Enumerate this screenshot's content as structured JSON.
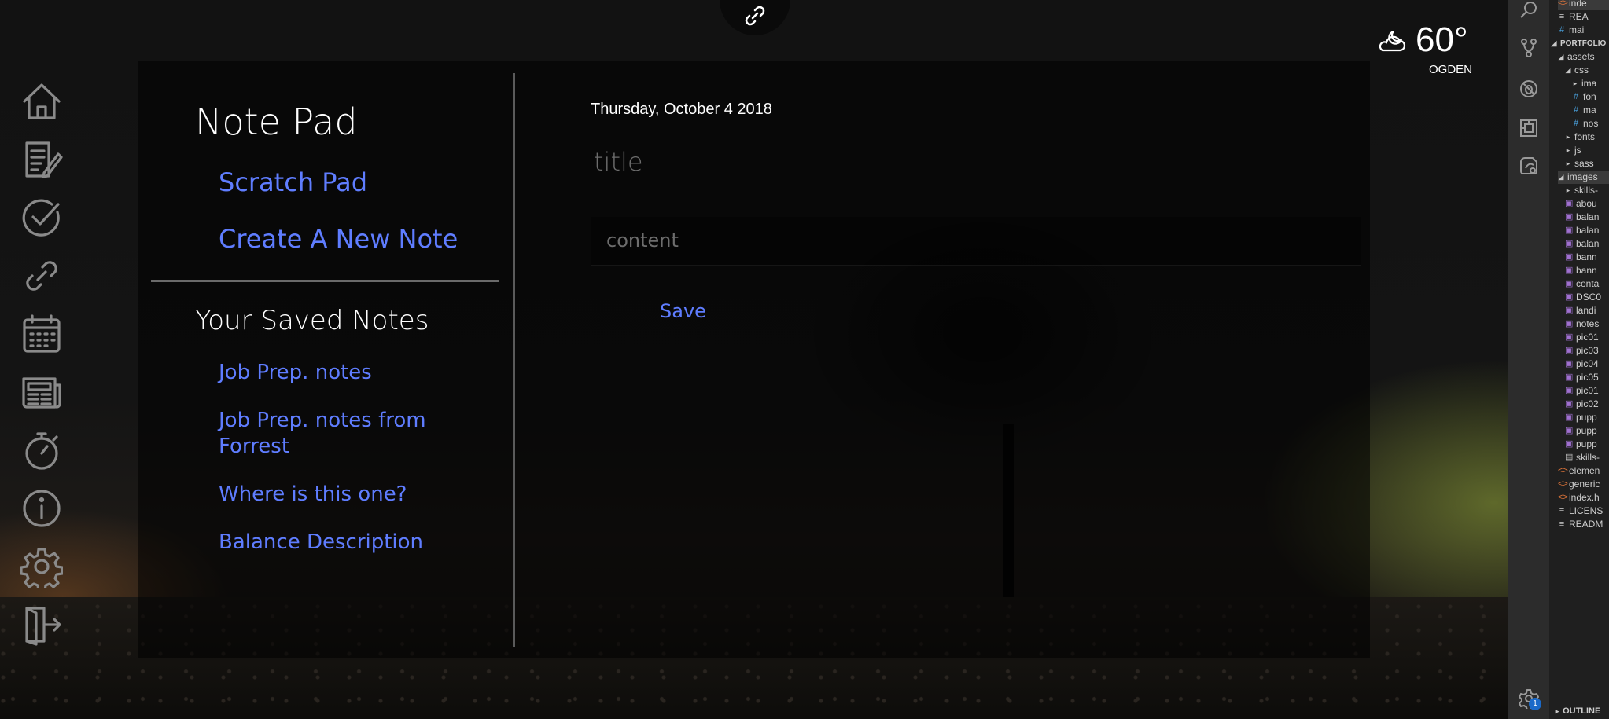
{
  "header": {
    "link_icon": "link-icon"
  },
  "weather": {
    "icon": "partly-cloudy-night-icon",
    "temperature": "60°",
    "city": "OGDEN"
  },
  "nav_rail": [
    {
      "icon": "home-icon"
    },
    {
      "icon": "notes-icon"
    },
    {
      "icon": "checklist-icon"
    },
    {
      "icon": "link-icon"
    },
    {
      "icon": "calendar-icon"
    },
    {
      "icon": "news-icon"
    },
    {
      "icon": "stopwatch-icon"
    },
    {
      "icon": "info-icon"
    },
    {
      "icon": "settings-icon"
    },
    {
      "icon": "logout-icon"
    }
  ],
  "sidebar": {
    "title": "Note Pad",
    "links": {
      "scratch": "Scratch Pad",
      "create": "Create A New Note"
    },
    "saved_title": "Your Saved Notes",
    "saved_notes": [
      "Job Prep. notes",
      "Job Prep. notes from Forrest",
      "Where is this one?",
      "Balance Description"
    ]
  },
  "editor": {
    "date": "Thursday, October 4 2018",
    "title_placeholder": "title",
    "content_placeholder": "content",
    "save_label": "Save"
  },
  "vscode": {
    "activity_icons": [
      "search-icon",
      "source-control-icon",
      "debug-icon",
      "extensions-icon",
      "remote-icon"
    ],
    "badge": "1",
    "explorer_rows": [
      {
        "label": "inde",
        "type": "html",
        "indent": 1,
        "highlight": true
      },
      {
        "label": "REA",
        "type": "md",
        "indent": 1
      },
      {
        "label": "mai",
        "type": "css",
        "indent": 1
      },
      {
        "label": "PORTFOLIO",
        "type": "section",
        "indent": 0
      },
      {
        "label": "assets",
        "type": "folder-open",
        "indent": 1
      },
      {
        "label": "css",
        "type": "folder-open",
        "indent": 2
      },
      {
        "label": "ima",
        "type": "folder",
        "indent": 3
      },
      {
        "label": "fon",
        "type": "css",
        "indent": 3
      },
      {
        "label": "ma",
        "type": "css",
        "indent": 3
      },
      {
        "label": "nos",
        "type": "css",
        "indent": 3
      },
      {
        "label": "fonts",
        "type": "folder",
        "indent": 2
      },
      {
        "label": "js",
        "type": "folder",
        "indent": 2
      },
      {
        "label": "sass",
        "type": "folder",
        "indent": 2
      },
      {
        "label": "images",
        "type": "folder-open",
        "indent": 1,
        "highlight": true
      },
      {
        "label": "skills-",
        "type": "folder",
        "indent": 2
      },
      {
        "label": "abou",
        "type": "img",
        "indent": 2
      },
      {
        "label": "balan",
        "type": "img",
        "indent": 2
      },
      {
        "label": "balan",
        "type": "img",
        "indent": 2
      },
      {
        "label": "balan",
        "type": "img",
        "indent": 2
      },
      {
        "label": "bann",
        "type": "img",
        "indent": 2
      },
      {
        "label": "bann",
        "type": "img",
        "indent": 2
      },
      {
        "label": "conta",
        "type": "img",
        "indent": 2
      },
      {
        "label": "DSC0",
        "type": "img",
        "indent": 2
      },
      {
        "label": "landi",
        "type": "img",
        "indent": 2
      },
      {
        "label": "notes",
        "type": "img",
        "indent": 2
      },
      {
        "label": "pic01",
        "type": "img",
        "indent": 2
      },
      {
        "label": "pic03",
        "type": "img",
        "indent": 2
      },
      {
        "label": "pic04",
        "type": "img",
        "indent": 2
      },
      {
        "label": "pic05",
        "type": "img",
        "indent": 2
      },
      {
        "label": "pic01",
        "type": "img",
        "indent": 2
      },
      {
        "label": "pic02",
        "type": "img",
        "indent": 2
      },
      {
        "label": "pupp",
        "type": "img",
        "indent": 2
      },
      {
        "label": "pupp",
        "type": "img",
        "indent": 2
      },
      {
        "label": "pupp",
        "type": "img",
        "indent": 2
      },
      {
        "label": "skills-",
        "type": "file",
        "indent": 2
      },
      {
        "label": "elemen",
        "type": "html",
        "indent": 1
      },
      {
        "label": "generic",
        "type": "html",
        "indent": 1
      },
      {
        "label": "index.h",
        "type": "html",
        "indent": 1
      },
      {
        "label": "LICENS",
        "type": "md",
        "indent": 1
      },
      {
        "label": "READM",
        "type": "md",
        "indent": 1
      }
    ],
    "outline_label": "OUTLINE"
  },
  "colors": {
    "link_blue": "#5f7dff",
    "panel_bg": "rgba(0,0,0,0.55)",
    "icon_gray": "#8a8a8a"
  }
}
